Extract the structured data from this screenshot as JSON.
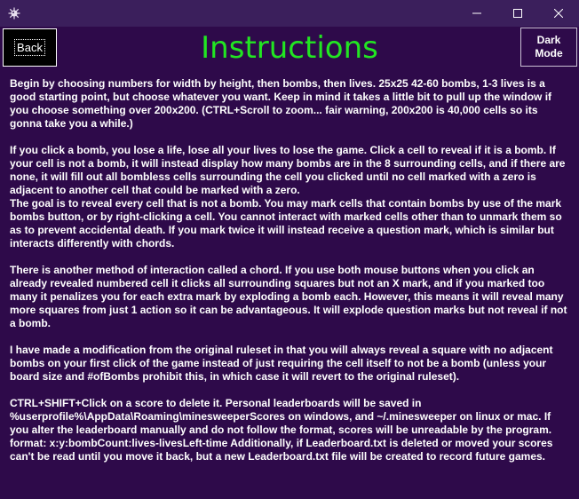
{
  "window": {
    "icon": "minesweeper-icon",
    "controls": [
      "minimize-icon",
      "maximize-icon",
      "close-icon"
    ]
  },
  "header": {
    "back_label": "Back",
    "title": "Instructions",
    "dark_mode_label": "Dark\nMode"
  },
  "colors": {
    "background": "#2e0a4a",
    "titlebar": "#3b1f5c",
    "title": "#22e622",
    "text": "#ffffff"
  },
  "instructions": {
    "p1": "Begin by choosing numbers for width by height, then bombs, then lives. 25x25 42-60 bombs, 1-3 lives is a good starting point, but choose whatever you want. Keep in mind it takes a little bit to pull up the window if you choose something over 200x200. (CTRL+Scroll to zoom... fair warning, 200x200 is 40,000 cells so its gonna take you a while.)",
    "p2": "If you click a bomb, you lose a life, lose all your lives to lose the game. Click a cell to reveal if it is a bomb. If your cell is not a bomb, it will instead display how many bombs are in the 8 surrounding cells, and if there are none, it will fill out all bombless cells surrounding the cell you clicked until no cell marked with a zero is adjacent to another cell that could be marked with a zero.",
    "p3": "The goal is to reveal every cell that is not a bomb. You may mark cells that contain bombs by use of the mark bombs button, or by right-clicking a cell. You cannot interact with marked cells other than to unmark them so as to prevent accidental death. If you mark twice it will instead receive a question mark, which is similar but interacts differently with chords.",
    "p4": "There is another method of interaction called a chord. If you use both mouse buttons when you click an already revealed numbered cell it clicks all surrounding squares but not an X mark, and if you marked too many it penalizes you for each extra mark by exploding a bomb each. However, this means it will reveal many more squares from just 1 action so it can be advantageous. It will explode question marks but not reveal if not a bomb.",
    "p5": "I have made a modification from the original ruleset in that you will always reveal a square with no adjacent bombs on your first click of the game instead of just requiring the cell itself to not be a bomb (unless your board size and #ofBombs prohibit this, in which case it will revert to the original ruleset).",
    "p6": "CTRL+SHIFT+Click on a score to delete it. Personal leaderboards will be saved in %userprofile%\\AppData\\Roaming\\minesweeperScores on windows, and ~/.minesweeper on linux or mac. If you alter the leaderboard manually and do not follow the format, scores will be unreadable by the program. format: x:y:bombCount:lives-livesLeft-time Additionally, if Leaderboard.txt is deleted or moved your scores can't be read until you move it back, but a new Leaderboard.txt file will be created to record future games."
  }
}
